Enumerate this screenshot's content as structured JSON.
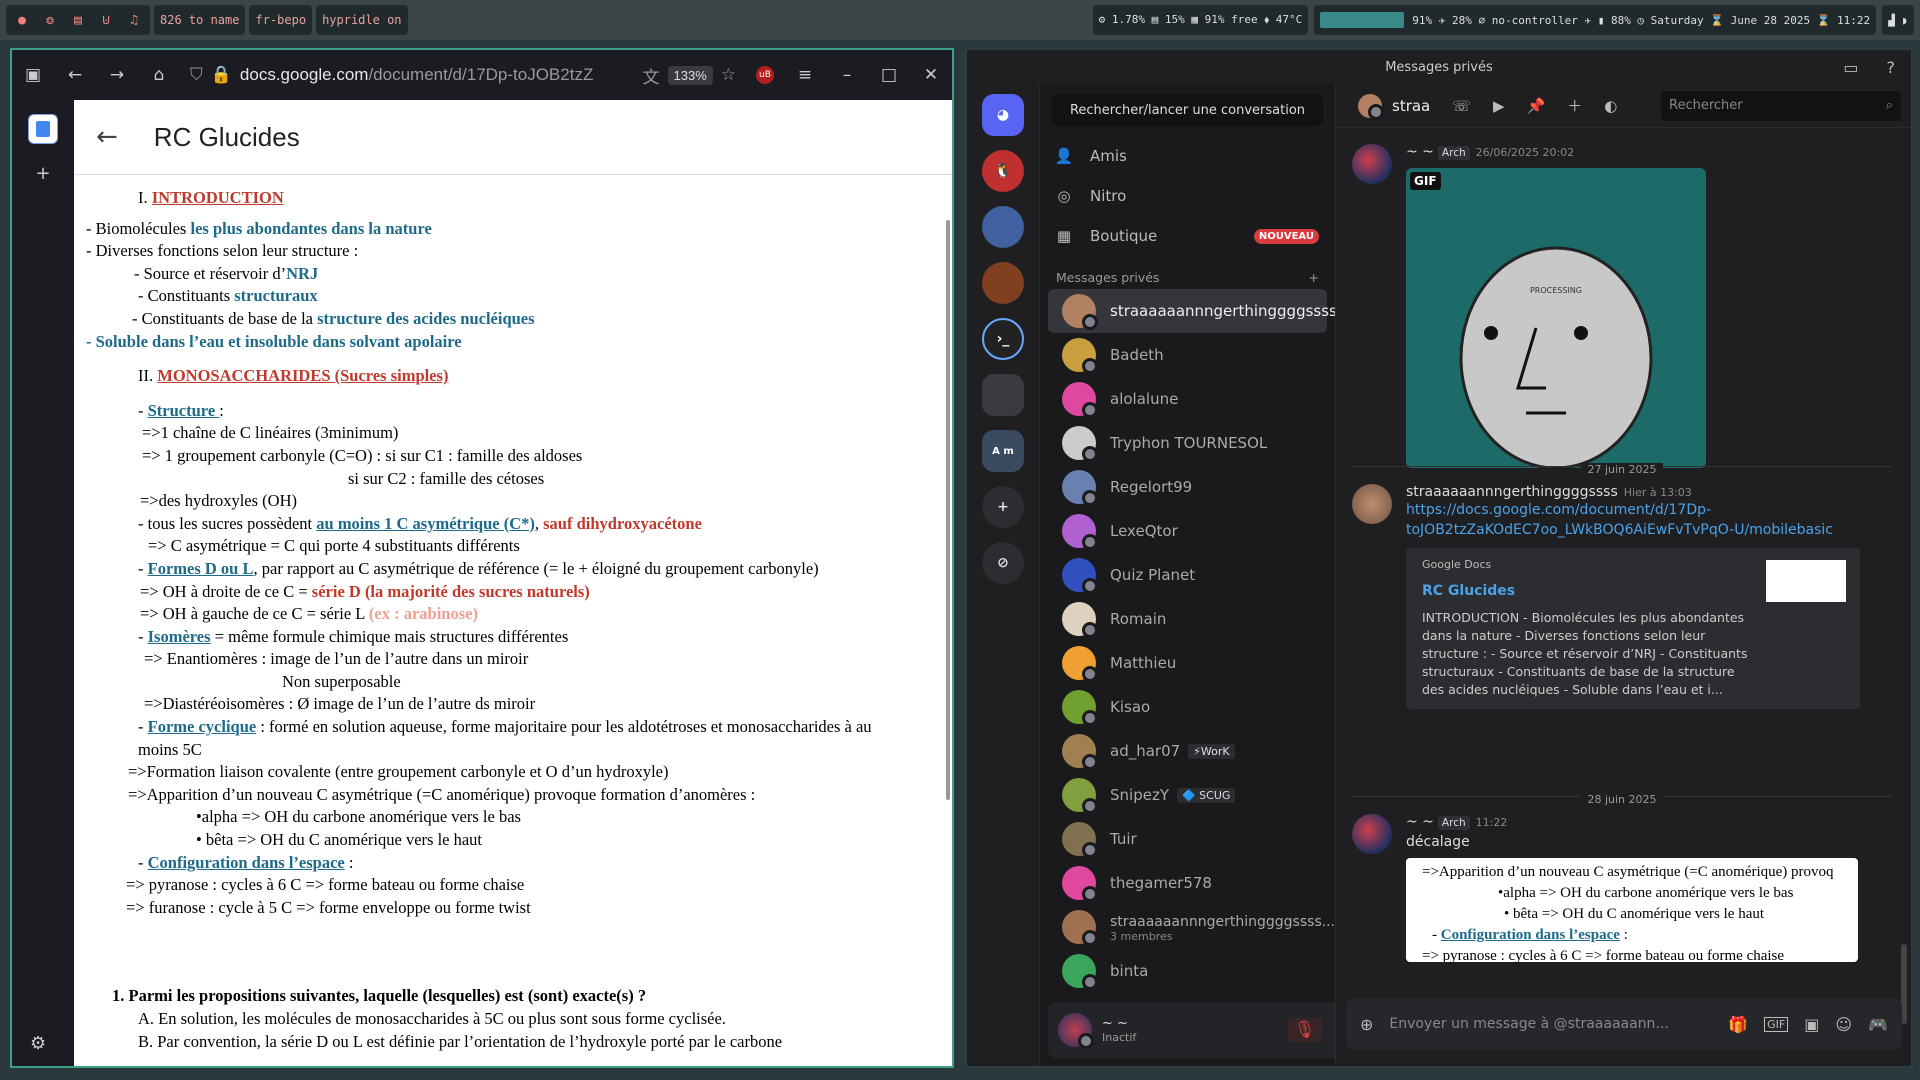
{
  "topbar": {
    "workspaces": [
      "●",
      "❂",
      "▤",
      "⊍",
      "♫"
    ],
    "chips": [
      "826 to name",
      "fr-bepo",
      "hypridle on"
    ],
    "stats": "⚙ 1.78% ▤ 15% ▦ 91% free ⬧ 47°C",
    "status": "91% ✈ 28% ⌀ no-controller ✈ ▮ 88% ◷ Saturday ⌛ June 28 2025 ⌛ 11:22"
  },
  "browser": {
    "url_host": "docs.google.com",
    "url_path": "/document/d/17Dp-toJOB2tzZ",
    "zoom": "133%",
    "ublock": "uB"
  },
  "doc": {
    "title": "RC Glucides",
    "h1": "I.",
    "h1t": "INTRODUCTION",
    "l1a": "- Biomolécules ",
    "l1b": "les plus abondantes dans la nature",
    "l2": "- Diverses fonctions selon leur structure :",
    "l3a": "- Source et réservoir d’",
    "l3b": "NRJ",
    "l4a": "- Constituants ",
    "l4b": "structuraux",
    "l5a": "- Constituants de base de la ",
    "l5b": "structure des acides nucléiques",
    "l6": "- Soluble dans l’eau et insoluble dans solvant apolaire",
    "h2": "II.",
    "h2t": "MONOSACCHARIDES (Sucres simples)",
    "s1a": "- ",
    "s1b": "Structure ",
    "s1c": ":",
    "s2": "=>1 chaîne de C linéaires (3minimum)",
    "s3": "=> 1 groupement carbonyle (C=O) : si sur C1 : famille des aldoses",
    "s4": "si sur C2 : famille des cétoses",
    "s5": "=>des hydroxyles (OH)",
    "s6a": "- tous les sucres possèdent ",
    "s6b": "au moins 1 C asymétrique (C*)",
    "s6c": ", ",
    "s6d": "sauf dihydroxyacétone",
    "s7": "=> C asymétrique = C qui porte 4 substituants différents",
    "s8a": "- ",
    "s8b": "Formes D ou L",
    "s8c": ", par rapport au C asymétrique de référence (= le + éloigné du groupement carbonyle)",
    "s9a": "=> OH à droite de ce C = ",
    "s9b": "série D (la majorité des sucres naturels)",
    "s10a": "=> OH à gauche de ce C = série L ",
    "s10b": "(ex : arabinose)",
    "s11a": "- ",
    "s11b": "Isomères",
    "s11c": " = même formule chimique mais structures différentes",
    "s12": "=> Enantiomères : image de l’un de l’autre dans un miroir",
    "s13": "Non superposable",
    "s14": "=>Diastéréoisomères : Ø image de l’un de l’autre ds miroir",
    "s15a": "- ",
    "s15b": "Forme cyclique",
    "s15c": " : formé en solution aqueuse, forme majoritaire pour les aldotétroses et monosaccharides à au",
    "s16": "moins 5C",
    "s17": "=>Formation liaison covalente (entre groupement carbonyle et O d’un hydroxyle)",
    "s18": "=>Apparition d’un nouveau C asymétrique (=C anomérique) provoque formation d’anomères :",
    "s19": "•alpha => OH du carbone anomérique vers le bas",
    "s20": "• bêta => OH du C anomérique vers le haut",
    "s21a": "- ",
    "s21b": "Configuration dans l’espace",
    "s21c": " :",
    "s22": "=> pyranose : cycles à 6 C => forme bateau ou forme chaise",
    "s23": "=> furanose : cycle à 5 C => forme enveloppe ou forme twist",
    "q1": "1. Parmi les propositions suivantes, laquelle (lesquelles) est (sont) exacte(s) ?",
    "qa": "A. En solution, les molécules de monosaccharides à 5C ou plus sont sous forme cyclisée.",
    "qb": "B. Par convention, la série D ou L est définie par l’orientation de l’hydroxyle porté par le carbone"
  },
  "discord": {
    "window_title": "Messages privés",
    "search_conv": "Rechercher/lancer une conversation",
    "nav": [
      {
        "label": "Amis",
        "icon": "👤"
      },
      {
        "label": "Nitro",
        "icon": "◎"
      },
      {
        "label": "Boutique",
        "icon": "▦",
        "badge": "NOUVEAU"
      }
    ],
    "dm_header": "Messages privés",
    "dms": [
      {
        "name": "straaaaaannngerthinggggssss",
        "color": "#b08060",
        "active": true
      },
      {
        "name": "Badeth",
        "color": "#c8a040"
      },
      {
        "name": "alolalune",
        "color": "#e048a0"
      },
      {
        "name": "Tryphon TOURNESOL",
        "color": "#ccc"
      },
      {
        "name": "Regelort99",
        "color": "#6a80b0"
      },
      {
        "name": "LexeQtor",
        "color": "#b060d0"
      },
      {
        "name": "Quiz Planet",
        "color": "#3050c0"
      },
      {
        "name": "Romain",
        "color": "#e0d0c0"
      },
      {
        "name": "Matthieu",
        "color": "#f0a030"
      },
      {
        "name": "Kisao",
        "color": "#70a030"
      },
      {
        "name": "ad_har07",
        "color": "#a08050",
        "tag": "⚡WorK"
      },
      {
        "name": "SnipezY",
        "color": "#80a040",
        "tag": "🔷 SCUG"
      },
      {
        "name": "Tuir",
        "color": "#807050"
      },
      {
        "name": "thegamer578",
        "color": "#e048a0"
      },
      {
        "name": "straaaaaannngerthinggggssss...",
        "color": "#a07050",
        "sub": "3 membres"
      },
      {
        "name": "binta",
        "color": "#3ba55c"
      }
    ],
    "user": {
      "name": "~ ~",
      "status": "Inactif"
    },
    "chat_name": "straa",
    "chat_search": "Rechercher",
    "m1": {
      "author": "~ ~",
      "tag": "Arch",
      "time": "26/06/2025 20:02",
      "gif": "GIF",
      "gif_text": "PROCESSING"
    },
    "d1": "27 juin 2025",
    "m2": {
      "author": "straaaaaannngerthinggggssss",
      "time": "Hier à 13:03",
      "link1": "https://docs.google.com/document/d/17Dp-",
      "link2": "toJOB2tzZaKOdEC7oo_LWkBOQ6AiEwFvTvPqO-U/mobilebasic",
      "provider": "Google Docs",
      "etitle": "RC Glucides",
      "edesc": "INTRODUCTION - Biomolécules les plus abondantes dans la nature - Diverses fonctions selon leur structure : - Source et réservoir d’NRJ - Constituants structuraux - Constituants de base de la structure des acides nucléiques - Soluble dans l’eau et i..."
    },
    "d2": "28 juin 2025",
    "m3": {
      "author": "~ ~",
      "tag": "Arch",
      "time": "11:22",
      "text": "décalage",
      "shot1": "=>Apparition d’un nouveau C asymétrique (=C anomérique) provoq",
      "shot2": "•alpha => OH du carbone anomérique vers le bas",
      "shot3": "• bêta => OH du C anomérique vers le haut",
      "shot4a": "- ",
      "shot4b": "Configuration dans l’espace",
      "shot4c": " :",
      "shot5": "=> pyranose : cycles à 6 C => forme bateau ou forme chaise"
    },
    "compose": "Envoyer un message à @straaaaaann..."
  }
}
